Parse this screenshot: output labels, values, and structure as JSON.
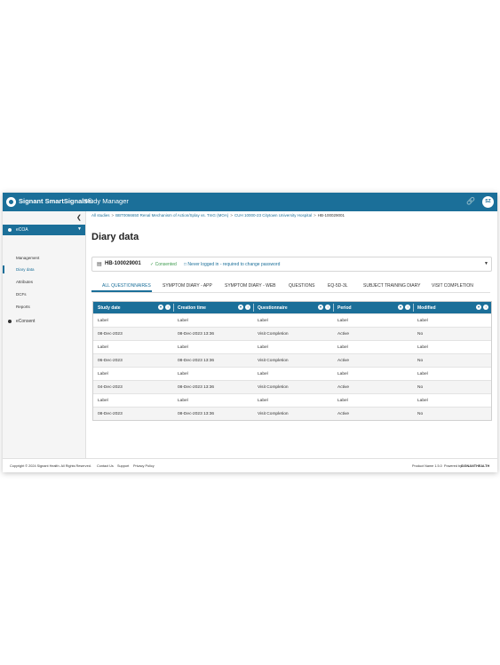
{
  "header": {
    "brand": "Signant SmartSignals®",
    "product": "Study Manager",
    "avatar": "SZ"
  },
  "sidebar": {
    "items": [
      {
        "label": "eCOA"
      },
      {
        "label": "Management"
      },
      {
        "label": "Diary data"
      },
      {
        "label": "Attributes"
      },
      {
        "label": "DCFs"
      },
      {
        "label": "Reports"
      },
      {
        "label": "eConsent"
      }
    ]
  },
  "breadcrumb": {
    "items": [
      "All studies",
      "BBT0066650 Renal Mechanism of Action/Splay vs. TmG (MOA)",
      "CUH 10000-23 Citytown University Hospital",
      "HB-100029001"
    ]
  },
  "page": {
    "title": "Diary data"
  },
  "participant": {
    "id": "HB-100029001",
    "consent": "Consented",
    "status": "Never logged in - required to change password"
  },
  "tabs": [
    "ALL QUESTIONNAIRES",
    "SYMPTOM DIARY - APP",
    "SYMPTOM DIARY - WEB",
    "QUESTIONS",
    "EQ-5D-3L",
    "SUBJECT TRAINING DIARY",
    "VISIT COMPLETION"
  ],
  "table": {
    "columns": [
      "Study date",
      "Creation time",
      "Questionnaire",
      "Period",
      "Modified"
    ],
    "rows": [
      [
        "Label",
        "Label",
        "Label",
        "Label",
        "Label"
      ],
      [
        "08-Dec-2023",
        "08-Dec-2023 13:36",
        "Visit Completion",
        "Active",
        "No"
      ],
      [
        "Label",
        "Label",
        "Label",
        "Label",
        "Label"
      ],
      [
        "06-Dec-2023",
        "08-Dec-2023 13:36",
        "Visit Completion",
        "Active",
        "No"
      ],
      [
        "Label",
        "Label",
        "Label",
        "Label",
        "Label"
      ],
      [
        "04-Dec-2023",
        "08-Dec-2023 13:36",
        "Visit Completion",
        "Active",
        "No"
      ],
      [
        "Label",
        "Label",
        "Label",
        "Label",
        "Label"
      ],
      [
        "08-Dec-2023",
        "08-Dec-2023 13:36",
        "Visit Completion",
        "Active",
        "No"
      ]
    ]
  },
  "footer": {
    "copyright": "Copyright © 2024 Signant Health. All Rights Reserved.",
    "links": [
      "Contact Us",
      "Support",
      "Privacy Policy"
    ],
    "version": "Product Name 1.5.0",
    "powered": "Powered by",
    "powered_brand": "SIGNANTHEALTH"
  },
  "colors": {
    "primary": "#1b6f99",
    "consent": "#3c9a4c"
  }
}
